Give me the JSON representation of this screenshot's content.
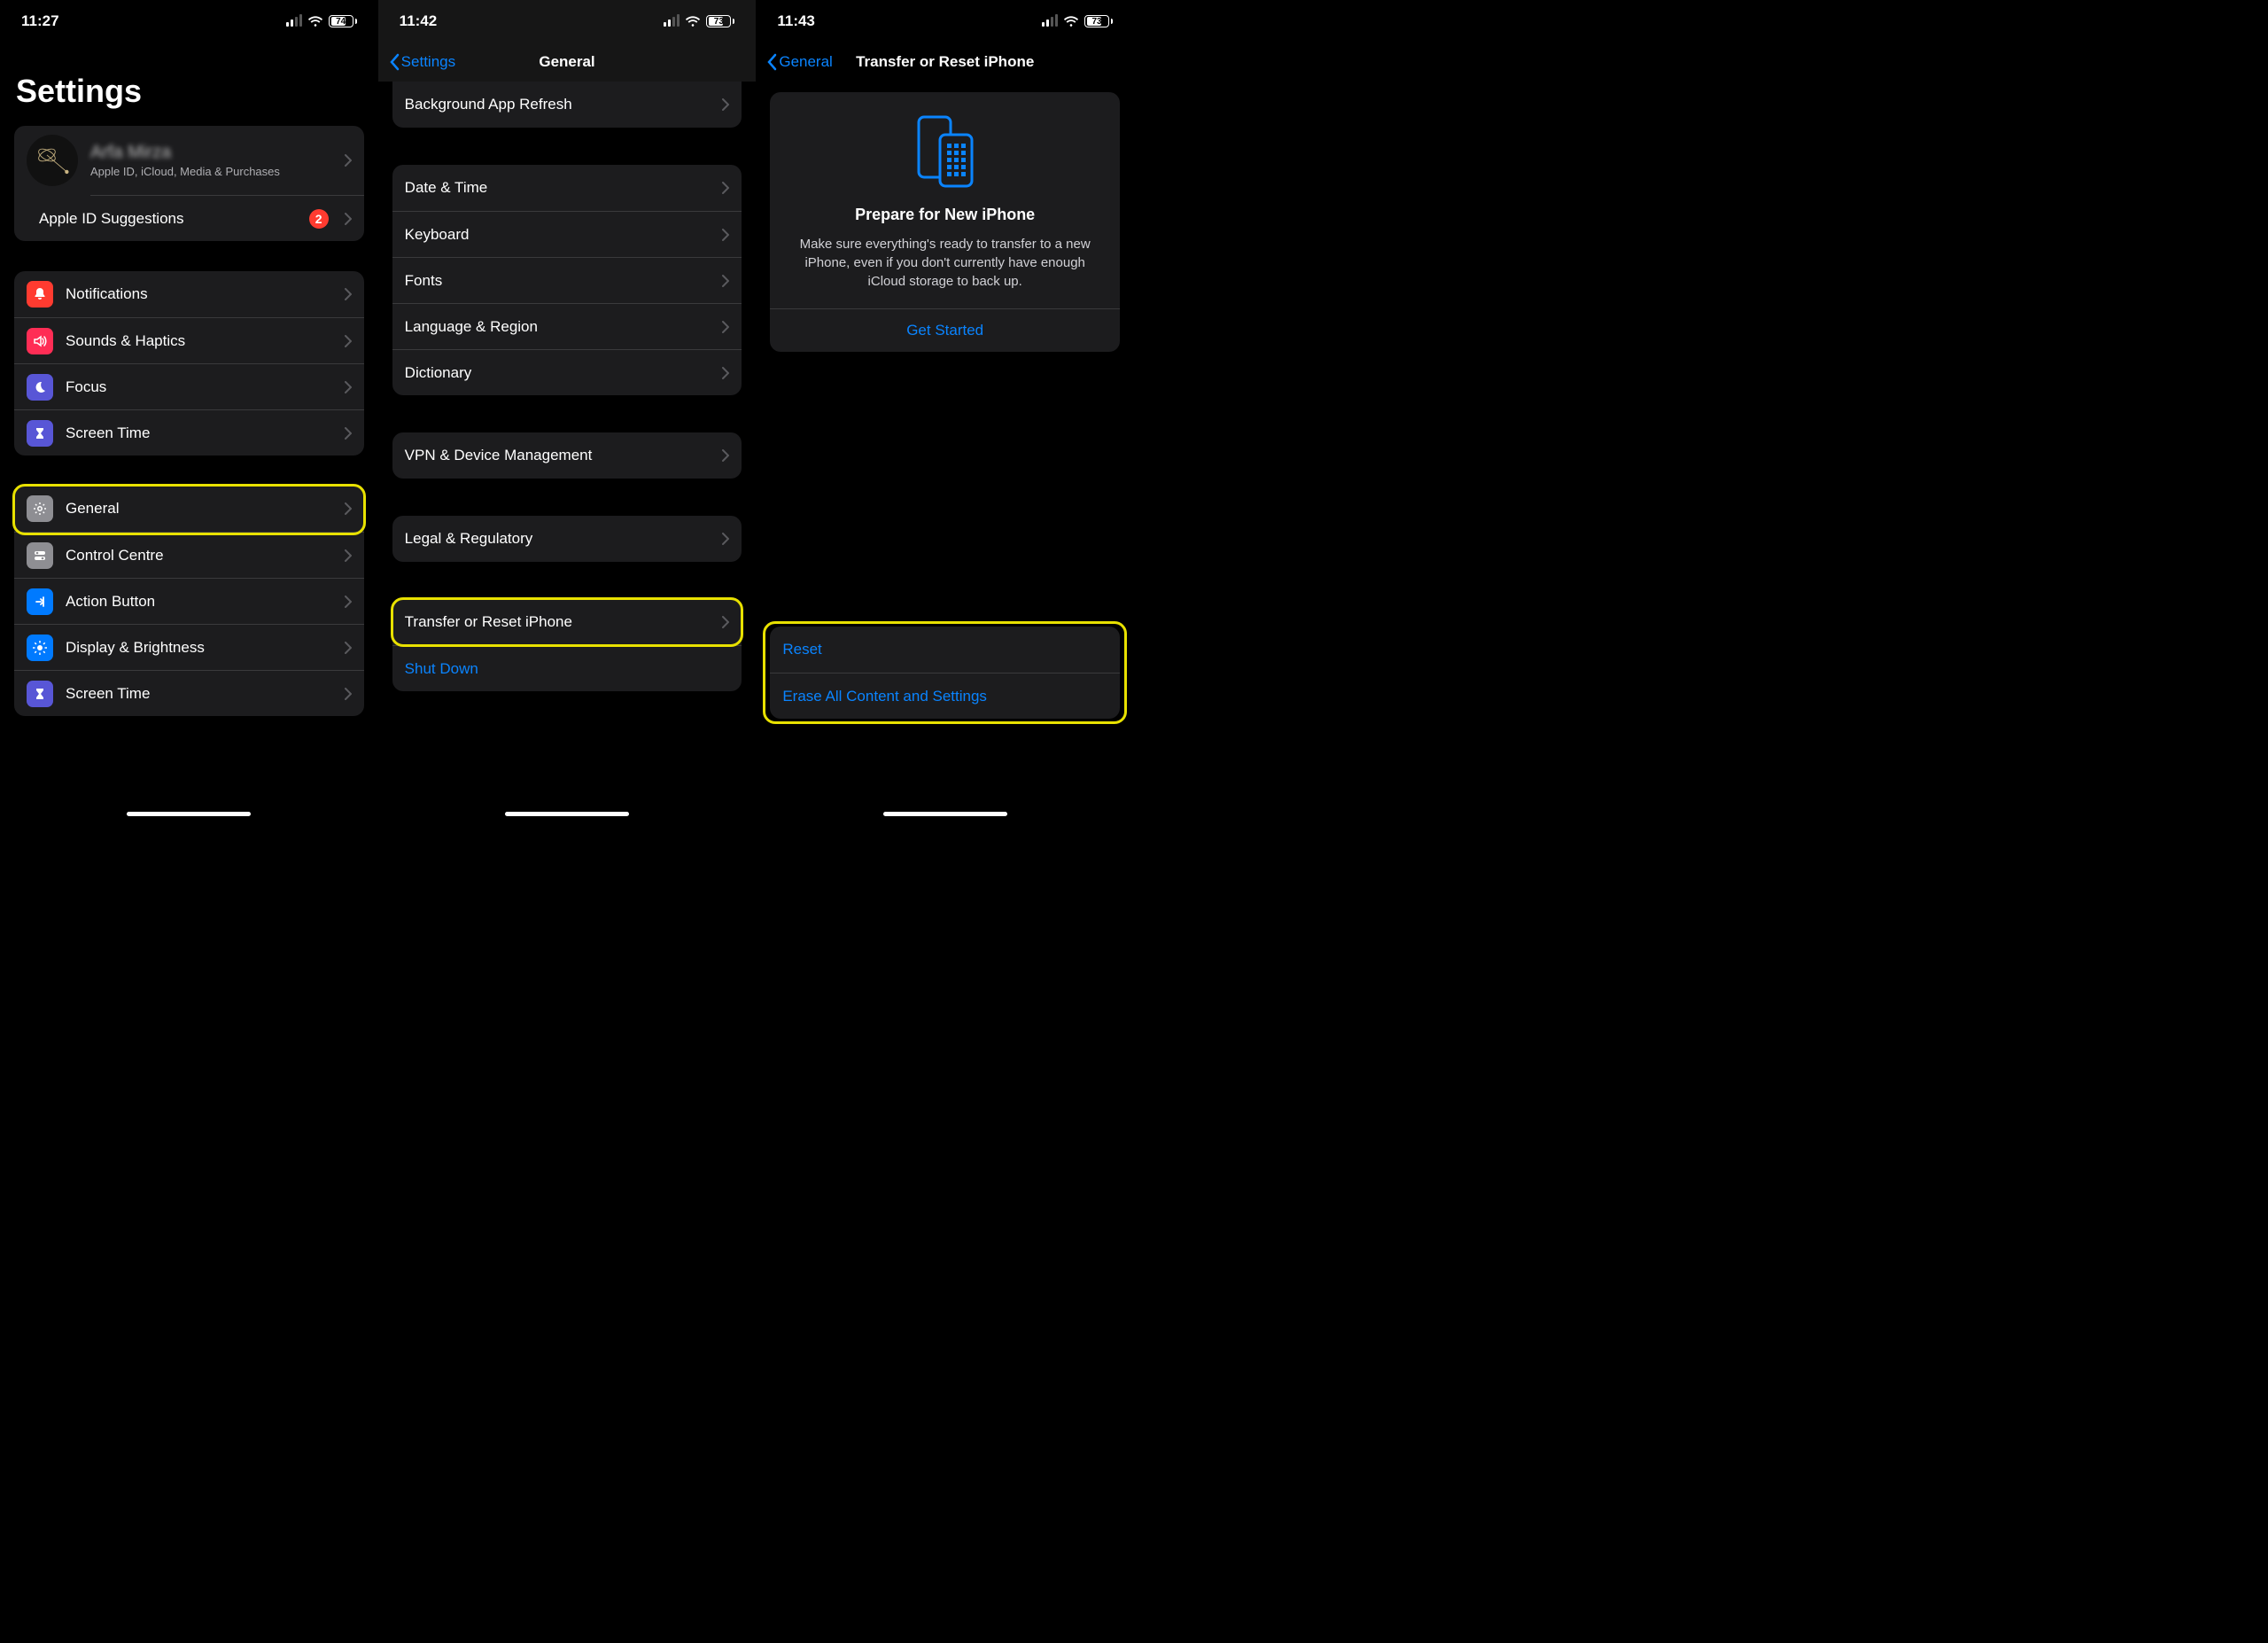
{
  "colors": {
    "accent": "#0a84ff",
    "badge": "#ff3b30",
    "highlight": "#e8e100"
  },
  "screen1": {
    "time": "11:27",
    "battery": "74",
    "title": "Settings",
    "profile": {
      "name": "Arfa Mirza",
      "subtitle": "Apple ID, iCloud, Media & Purchases"
    },
    "apple_id_row": {
      "label": "Apple ID Suggestions",
      "badge": "2"
    },
    "group1": [
      {
        "icon": "bell-icon",
        "bg": "#ff3b30",
        "label": "Notifications"
      },
      {
        "icon": "speaker-icon",
        "bg": "#ff2d55",
        "label": "Sounds & Haptics"
      },
      {
        "icon": "moon-icon",
        "bg": "#5856d6",
        "label": "Focus"
      },
      {
        "icon": "hourglass-icon",
        "bg": "#5856d6",
        "label": "Screen Time"
      }
    ],
    "group2": [
      {
        "icon": "gear-icon",
        "bg": "#8e8e93",
        "label": "General",
        "highlight": true
      },
      {
        "icon": "switches-icon",
        "bg": "#8e8e93",
        "label": "Control Centre"
      },
      {
        "icon": "action-icon",
        "bg": "#007aff",
        "label": "Action Button"
      },
      {
        "icon": "brightness-icon",
        "bg": "#007aff",
        "label": "Display & Brightness"
      },
      {
        "icon": "hourglass-icon",
        "bg": "#5856d6",
        "label": "Screen Time"
      }
    ]
  },
  "screen2": {
    "time": "11:42",
    "battery": "73",
    "back": "Settings",
    "title": "General",
    "top": [
      {
        "label": "Background App Refresh"
      }
    ],
    "group1": [
      {
        "label": "Date & Time"
      },
      {
        "label": "Keyboard"
      },
      {
        "label": "Fonts"
      },
      {
        "label": "Language & Region"
      },
      {
        "label": "Dictionary"
      }
    ],
    "group2": [
      {
        "label": "VPN & Device Management"
      }
    ],
    "group3": [
      {
        "label": "Legal & Regulatory"
      }
    ],
    "group4": [
      {
        "label": "Transfer or Reset iPhone",
        "highlight": true
      },
      {
        "label": "Shut Down",
        "link": true,
        "no_chevron": true
      }
    ]
  },
  "screen3": {
    "time": "11:43",
    "battery": "73",
    "back": "General",
    "title": "Transfer or Reset iPhone",
    "card": {
      "heading": "Prepare for New iPhone",
      "body": "Make sure everything's ready to transfer to a new iPhone, even if you don't currently have enough iCloud storage to back up.",
      "button": "Get Started"
    },
    "actions": [
      {
        "label": "Reset"
      },
      {
        "label": "Erase All Content and Settings"
      }
    ]
  }
}
